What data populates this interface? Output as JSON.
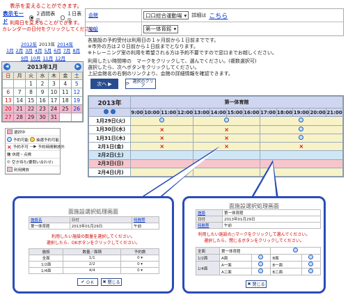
{
  "left": {
    "display_change_text": "表示を変えることができます。",
    "display_mode_label": "表示モード",
    "radio_2weeks": "２週間表示",
    "radio_1day": "１日表示",
    "usage_day_note1": "利用日を変えることができます。",
    "usage_day_note2": "カレンダーの日付をクリックしてください。",
    "year_links": [
      "2012年",
      "2013年",
      "2014年"
    ],
    "month_links": [
      "1月",
      "2月",
      "3月",
      "4月",
      "5月",
      "6月",
      "7月",
      "8月",
      "9月",
      "10月",
      "11月",
      "12月"
    ],
    "calendar": {
      "title": "2013年1月",
      "weekdays": [
        "日",
        "月",
        "火",
        "水",
        "木",
        "金",
        "土"
      ],
      "weeks": [
        [
          "",
          "",
          "1",
          "2",
          "3",
          "4",
          "5"
        ],
        [
          "6",
          "7",
          "8",
          "9",
          "10",
          "11",
          "12"
        ],
        [
          "13",
          "14",
          "15",
          "16",
          "17",
          "18",
          "19"
        ],
        [
          "20",
          "21",
          "22",
          "23",
          "24",
          "25",
          "26"
        ],
        [
          "27",
          "28",
          "29",
          "30",
          "31",
          "",
          ""
        ]
      ]
    },
    "legend": [
      "選択中",
      "予約可能",
      "抽選予約可能",
      "予約不可",
      "予約時間開放外",
      "休館・点検",
      "空き待ち(要問い合わせ)",
      "利用開放"
    ]
  },
  "info": {
    "hall_label": "会館",
    "hall_value": "口口総合運動場",
    "detail_label": "詳細は",
    "detail_link": "こちら",
    "facility_label": "施設",
    "facility_value": "第一体育館"
  },
  "notes": [
    "各施設の予約受付は利用日の１ヶ月前から１日前までです。",
    "※市外の方は２０日前から１日前までとなります。",
    "※トレーニング室の利用を希望される方は予約不要ですので窓口までお越しください。"
  ],
  "instruct": {
    "line1": "利用したい時間帯の　マークをクリックして、選んでください。(複数選択可)",
    "line2": "選択したら、次へボタンをクリックしてください。",
    "line3": "上記会館名の右側のリンクより、会館の詳細情報を確認できます。",
    "next_button": "次へ",
    "clear_button": "選択のクリア"
  },
  "schedule": {
    "year": "2013年",
    "facility": "第一体育館",
    "hours": [
      "9:00",
      "10:00",
      "11:00",
      "12:00",
      "13:00",
      "14:00",
      "15:00",
      "16:00",
      "17:00",
      "18:00",
      "19:00",
      "20:00",
      "21:00"
    ],
    "days": [
      "1月29日(火)",
      "1月30日(水)",
      "1月31日(木)",
      "2月1日(金)",
      "2月2日(土)",
      "2月3日(日)",
      "2月4日(月)"
    ]
  },
  "popup_left": {
    "title": "面施設選択処理画面",
    "head": [
      "施設名",
      "日付",
      "時間帯"
    ],
    "values": [
      "第一体育館",
      "2013年01月29日",
      "午前"
    ],
    "msg1": "利用したい施設の数量を選択してください。",
    "msg2": "選択したら、OKボタンをクリックしてください。",
    "cols": [
      "施設",
      "数量／面積",
      "予約数"
    ],
    "rows": [
      [
        "全面",
        "1/1",
        "0"
      ],
      [
        "1/2面",
        "2/2",
        "0"
      ],
      [
        "1/4面",
        "4/4",
        "0"
      ]
    ],
    "ok": "ＯＫ",
    "close": "閉じる"
  },
  "popup_right": {
    "title": "面施設選択処理画面",
    "head": [
      "施設",
      "日付",
      "時間帯"
    ],
    "values": [
      "第一体育館",
      "2013年01月29日",
      "午前"
    ],
    "msg1": "利用したい施設の○マークをクリックして選んでください。",
    "msg2": "選択したら、閉じるボタンをクリックしてください。",
    "rows": [
      [
        "全面",
        "第一体育館"
      ],
      [
        "1/2面",
        "A面",
        "B面"
      ],
      [
        "1/4面",
        "A一面",
        "A二面",
        "B一面",
        "B二面"
      ]
    ],
    "close": "閉じる"
  }
}
